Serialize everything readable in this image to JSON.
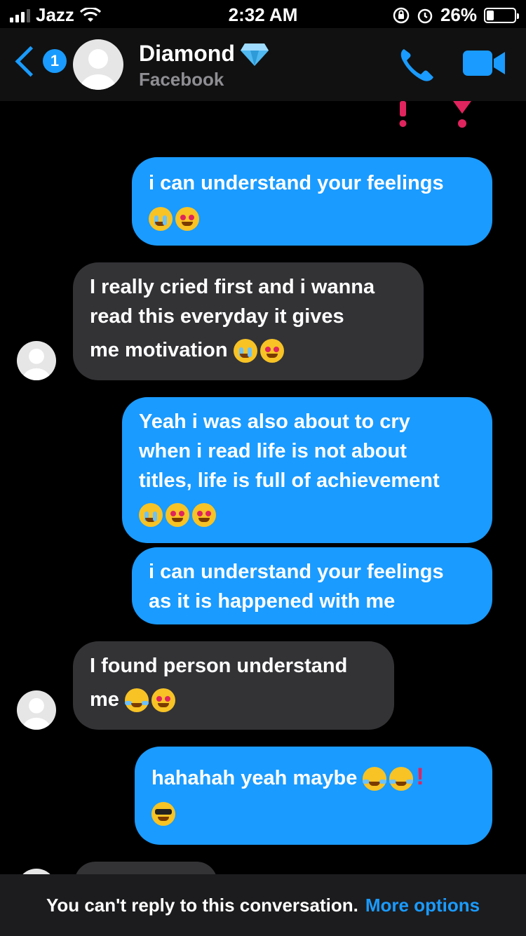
{
  "status": {
    "carrier": "Jazz",
    "time": "2:32 AM",
    "battery_text": "26%",
    "battery_level": 0.26
  },
  "header": {
    "back_badge": "1",
    "name": "Diamond",
    "subtitle": "Facebook"
  },
  "messages": [
    {
      "side": "sent",
      "lines": [
        "i can understand your feelings"
      ]
    },
    {
      "side": "recv",
      "lines": [
        "I really cried first and i wanna",
        "read this everyday it gives",
        "me motivation"
      ]
    },
    {
      "side": "sent",
      "lines": [
        "Yeah i was also about to cry",
        "when i read life is not about",
        "titles, life is full of achievement"
      ]
    },
    {
      "side": "sent",
      "lines": [
        "i can understand your feelings",
        "as it is happened with me"
      ]
    },
    {
      "side": "recv",
      "lines": [
        "I found person understand",
        "me"
      ]
    },
    {
      "side": "sent",
      "lines": [
        "hahahah yeah maybe"
      ]
    }
  ],
  "footer": {
    "notice": "You can't reply to this conversation.",
    "more_options": "More options"
  },
  "colors": {
    "accent": "#1a9bff",
    "sent_bubble": "#1a9bff",
    "recv_bubble": "#333336"
  }
}
